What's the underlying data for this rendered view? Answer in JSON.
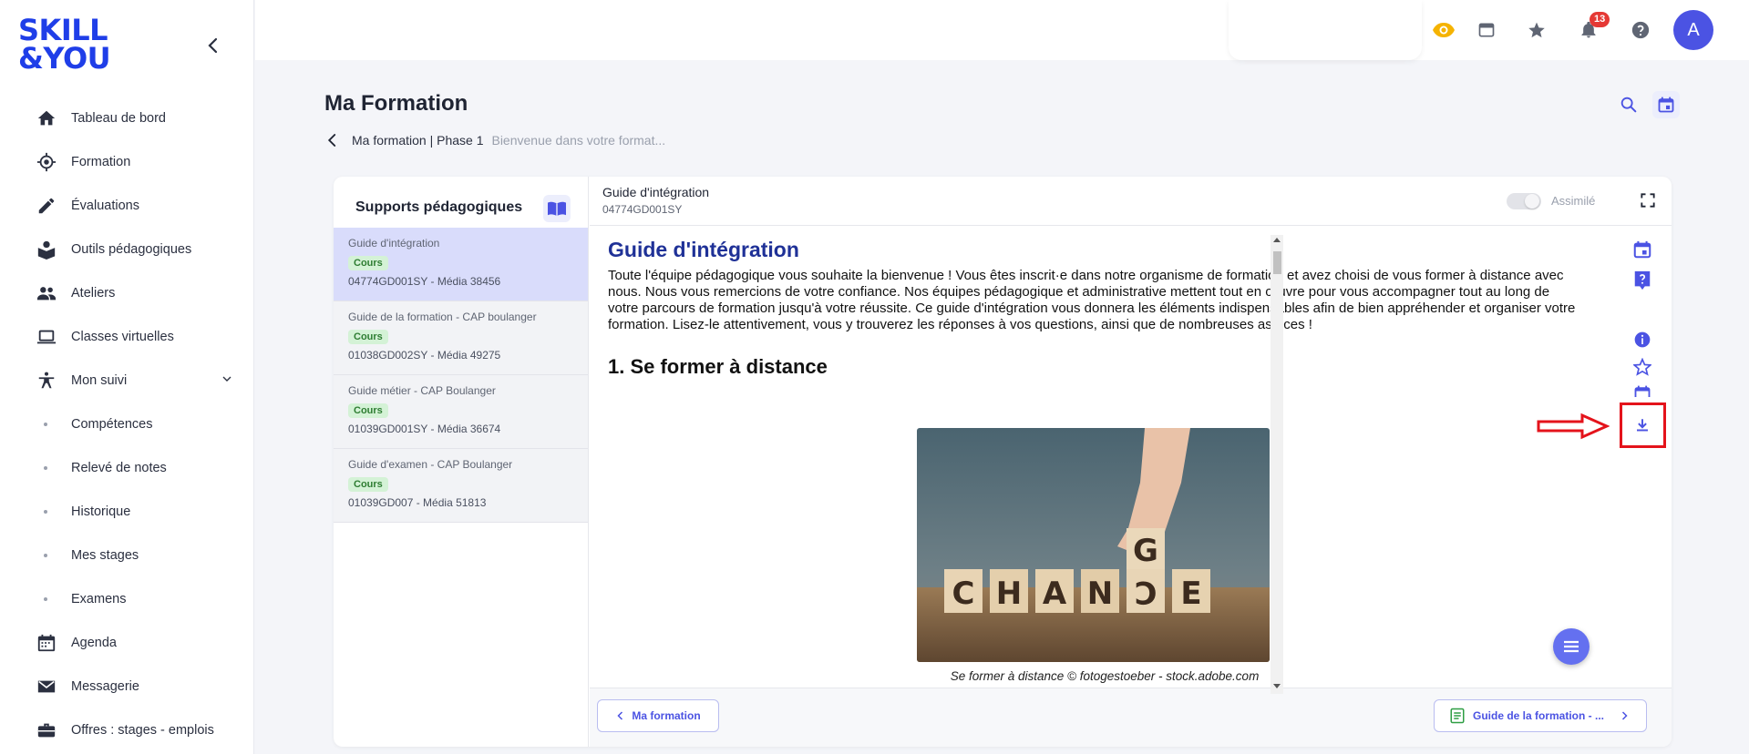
{
  "brand": {
    "logo_line1": "SKILL",
    "logo_line2": "&YOU",
    "color": "#1f3ee8"
  },
  "sidebar": {
    "items": [
      {
        "label": "Tableau de bord",
        "icon": "home-icon"
      },
      {
        "label": "Formation",
        "icon": "target-icon"
      },
      {
        "label": "Évaluations",
        "icon": "pencil-icon"
      },
      {
        "label": "Outils pédagogiques",
        "icon": "reader-icon"
      },
      {
        "label": "Ateliers",
        "icon": "group-icon"
      },
      {
        "label": "Classes virtuelles",
        "icon": "laptop-icon"
      },
      {
        "label": "Mon suivi",
        "icon": "accessibility-icon"
      }
    ],
    "sub_items": [
      "Compétences",
      "Relevé de notes",
      "Historique",
      "Mes stages",
      "Examens"
    ],
    "bottom_items": [
      {
        "label": "Agenda",
        "icon": "calendar-icon"
      },
      {
        "label": "Messagerie",
        "icon": "mail-icon"
      },
      {
        "label": "Offres : stages - emplois",
        "icon": "briefcase-icon"
      }
    ]
  },
  "topbar": {
    "notifications_count": "13",
    "avatar_initial": "A",
    "eye_color": "#f5b301"
  },
  "header": {
    "title": "Ma Formation",
    "breadcrumb_current": "Ma formation | Phase 1",
    "breadcrumb_subtitle": "Bienvenue dans votre format..."
  },
  "supports": {
    "title": "Supports pédagogiques",
    "items": [
      {
        "title": "Guide d'intégration",
        "tag": "Cours",
        "code": "04774GD001SY - Média 38456"
      },
      {
        "title": "Guide de la formation - CAP boulanger",
        "tag": "Cours",
        "code": "01038GD002SY - Média 49275"
      },
      {
        "title": "Guide métier - CAP Boulanger",
        "tag": "Cours",
        "code": "01039GD001SY - Média 36674"
      },
      {
        "title": "Guide d'examen - CAP Boulanger",
        "tag": "Cours",
        "code": "01039GD007 - Média 51813"
      }
    ]
  },
  "document": {
    "title": "Guide d'intégration",
    "code": "04774GD001SY",
    "toggle_label": "Assimilé",
    "heading": "Guide d'intégration",
    "intro": "Toute l'équipe pédagogique vous souhaite la bienvenue ! Vous êtes inscrit·e dans notre organisme de formation et avez choisi de vous former à distance avec nous. Nous vous remercions de votre confiance. Nos équipes pédagogique et administrative mettent tout en œuvre pour vous accompagner tout au long de votre parcours de formation jusqu'à votre réussite. Ce guide d'intégration vous donnera les éléments indispensables afin de bien appréhender et organiser votre formation. Lisez-le attentivement, vous y trouverez les réponses à vos questions, ainsi que de nombreuses astuces !",
    "section1": "1. Se former à distance",
    "image_caption": "Se former à distance © fotogestoeber - stock.adobe.com",
    "image_letters": [
      "C",
      "H",
      "A",
      "N",
      "C",
      "E",
      "G"
    ]
  },
  "footer": {
    "prev_label": "Ma formation",
    "next_label": "Guide de la formation - ..."
  },
  "colors": {
    "accent": "#4b53e3",
    "annotation": "#e4131b",
    "active_row": "#d9dcfb"
  }
}
